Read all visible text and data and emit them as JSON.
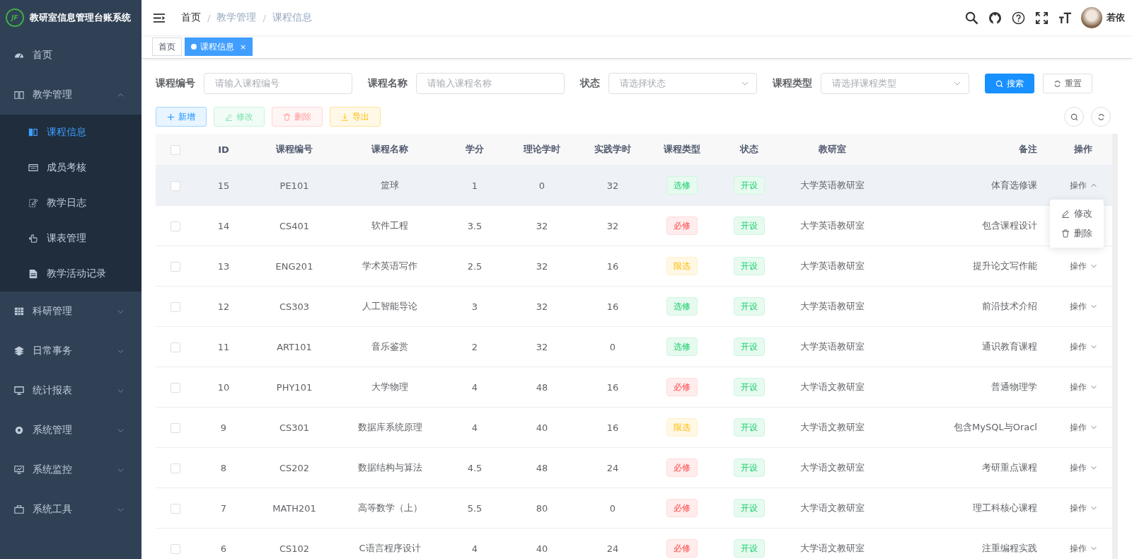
{
  "logo": {
    "text": "JF",
    "title": "教研室信息管理台账系统"
  },
  "sidebar": {
    "items": [
      {
        "label": "首页"
      },
      {
        "label": "教学管理",
        "expanded": true,
        "children": [
          {
            "label": "课程信息",
            "selected": true
          },
          {
            "label": "成员考核",
            "selected": false
          },
          {
            "label": "教学日志",
            "selected": false
          },
          {
            "label": "课表管理",
            "selected": false
          },
          {
            "label": "教学活动记录",
            "selected": false
          }
        ]
      },
      {
        "label": "科研管理",
        "expanded": false
      },
      {
        "label": "日常事务",
        "expanded": false
      },
      {
        "label": "统计报表",
        "expanded": false
      },
      {
        "label": "系统管理",
        "expanded": false
      },
      {
        "label": "系统监控",
        "expanded": false
      },
      {
        "label": "系统工具",
        "expanded": false
      }
    ]
  },
  "breadcrumb": {
    "items": [
      "首页",
      "教学管理",
      "课程信息"
    ],
    "separators": [
      "/",
      "/"
    ]
  },
  "user": {
    "name": "若依"
  },
  "tabs": [
    {
      "label": "首页",
      "selected": false
    },
    {
      "label": "课程信息",
      "selected": true,
      "close": "×"
    }
  ],
  "filters": [
    {
      "label": "课程编号",
      "placeholder": "请输入课程编号",
      "kind": "input"
    },
    {
      "label": "课程名称",
      "placeholder": "请输入课程名称",
      "kind": "input"
    },
    {
      "label": "状态",
      "placeholder": "请选择状态",
      "kind": "select"
    },
    {
      "label": "课程类型",
      "placeholder": "请选择课程类型",
      "kind": "select"
    }
  ],
  "search_button": "搜索",
  "reset_button": "重置",
  "actions": [
    {
      "label": "新增",
      "kind": "add",
      "disabled": false
    },
    {
      "label": "修改",
      "kind": "edit",
      "disabled": true
    },
    {
      "label": "删除",
      "kind": "delete",
      "disabled": true
    },
    {
      "label": "导出",
      "kind": "export",
      "disabled": false
    }
  ],
  "table": {
    "select_all_checked": false,
    "columns": [
      "ID",
      "课程编号",
      "课程名称",
      "学分",
      "理论学时",
      "实践学时",
      "课程类型",
      "状态",
      "教研室",
      "备注",
      "操作"
    ],
    "rows": [
      {
        "id": "15",
        "code": "PE101",
        "name": "篮球",
        "credit": "1",
        "theory": "0",
        "practice": "32",
        "type": {
          "label": "选修",
          "kind": "elective"
        },
        "status": {
          "label": "开设",
          "kind": "open"
        },
        "office": "大学英语教研室",
        "note": "体育选修课",
        "op": "操作",
        "checked": false,
        "highlighted": true,
        "menu_open": true
      },
      {
        "id": "14",
        "code": "CS401",
        "name": "软件工程",
        "credit": "3.5",
        "theory": "32",
        "practice": "32",
        "type": {
          "label": "必修",
          "kind": "required"
        },
        "status": {
          "label": "开设",
          "kind": "open"
        },
        "office": "大学英语教研室",
        "note": "包含课程设计",
        "checked": false,
        "highlighted": false
      },
      {
        "id": "13",
        "code": "ENG201",
        "name": "学术英语写作",
        "credit": "2.5",
        "theory": "32",
        "practice": "16",
        "type": {
          "label": "限选",
          "kind": "limited"
        },
        "status": {
          "label": "开设",
          "kind": "open"
        },
        "office": "大学英语教研室",
        "note": "提升论文写作能",
        "op": "操作",
        "checked": false,
        "highlighted": false,
        "menu_open": false
      },
      {
        "id": "12",
        "code": "CS303",
        "name": "人工智能导论",
        "credit": "3",
        "theory": "32",
        "practice": "16",
        "type": {
          "label": "选修",
          "kind": "elective"
        },
        "status": {
          "label": "开设",
          "kind": "open"
        },
        "office": "大学英语教研室",
        "note": "前沿技术介绍",
        "op": "操作",
        "checked": false,
        "highlighted": false,
        "menu_open": false
      },
      {
        "id": "11",
        "code": "ART101",
        "name": "音乐鉴赏",
        "credit": "2",
        "theory": "32",
        "practice": "0",
        "type": {
          "label": "选修",
          "kind": "elective"
        },
        "status": {
          "label": "开设",
          "kind": "open"
        },
        "office": "大学英语教研室",
        "note": "通识教育课程",
        "op": "操作",
        "checked": false,
        "highlighted": false,
        "menu_open": false
      },
      {
        "id": "10",
        "code": "PHY101",
        "name": "大学物理",
        "credit": "4",
        "theory": "48",
        "practice": "16",
        "type": {
          "label": "必修",
          "kind": "required"
        },
        "status": {
          "label": "开设",
          "kind": "open"
        },
        "office": "大学语文教研室",
        "note": "普通物理学",
        "op": "操作",
        "checked": false,
        "highlighted": false,
        "menu_open": false
      },
      {
        "id": "9",
        "code": "CS301",
        "name": "数据库系统原理",
        "credit": "4",
        "theory": "40",
        "practice": "16",
        "type": {
          "label": "限选",
          "kind": "limited"
        },
        "status": {
          "label": "开设",
          "kind": "open"
        },
        "office": "大学语文教研室",
        "note": "包含MySQL与Oracl",
        "op": "操作",
        "checked": false,
        "highlighted": false,
        "menu_open": false
      },
      {
        "id": "8",
        "code": "CS202",
        "name": "数据结构与算法",
        "credit": "4.5",
        "theory": "48",
        "practice": "24",
        "type": {
          "label": "必修",
          "kind": "required"
        },
        "status": {
          "label": "开设",
          "kind": "open"
        },
        "office": "大学语文教研室",
        "note": "考研重点课程",
        "op": "操作",
        "checked": false,
        "highlighted": false,
        "menu_open": false
      },
      {
        "id": "7",
        "code": "MATH201",
        "name": "高等数学（上）",
        "credit": "5.5",
        "theory": "80",
        "practice": "0",
        "type": {
          "label": "必修",
          "kind": "required"
        },
        "status": {
          "label": "开设",
          "kind": "open"
        },
        "office": "大学语文教研室",
        "note": "理工科核心课程",
        "op": "操作",
        "checked": false,
        "highlighted": false,
        "menu_open": false
      },
      {
        "id": "6",
        "code": "CS102",
        "name": "C语言程序设计",
        "credit": "4",
        "theory": "40",
        "practice": "24",
        "type": {
          "label": "必修",
          "kind": "required"
        },
        "status": {
          "label": "开设",
          "kind": "open"
        },
        "office": "大学语文教研室",
        "note": "注重编程实践",
        "op": "操作",
        "checked": false,
        "highlighted": false,
        "menu_open": false
      }
    ]
  },
  "row_menu": [
    "修改",
    "删除"
  ]
}
